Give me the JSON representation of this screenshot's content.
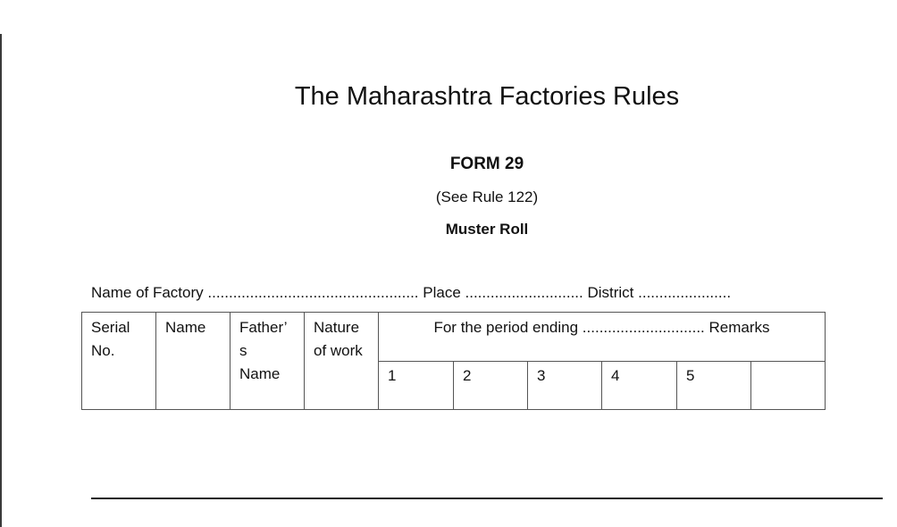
{
  "document": {
    "title": "The Maharashtra Factories Rules",
    "form_number": "FORM 29",
    "rule_reference": "(See Rule 122)",
    "subtitle": "Muster Roll",
    "fields_line": "Name of Factory .................................................. Place ............................ District ......................",
    "table": {
      "headers": {
        "serial_no": "Serial No.",
        "name": "Name",
        "fathers_name_line1": "Father’",
        "fathers_name_line2": "s",
        "fathers_name_line3": "Name",
        "nature_of_work": "Nature of work",
        "period_ending": "For the period ending ............................. Remarks"
      },
      "day_columns": [
        "1",
        "2",
        "3",
        "4",
        "5",
        ""
      ]
    }
  }
}
